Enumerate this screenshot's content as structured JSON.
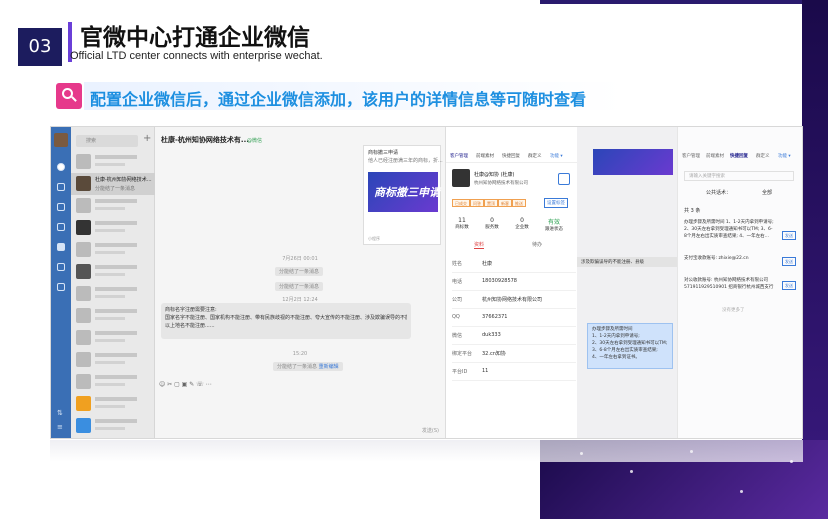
{
  "header": {
    "number": "03",
    "title": "官微中心打通企业微信",
    "subtitle": "Official LTD center connects with enterprise wechat."
  },
  "banner": {
    "text": "配置企业微信后，通过企业微信添加，该用户的详情信息等可随时查看"
  },
  "chat": {
    "search_placeholder": "搜索",
    "selected_name": "杜康-杭州知协网络技术...",
    "selected_preview": "分能结了一条消息",
    "title": "杜康-杭州知协网络技术有...",
    "tag": "@微信",
    "time1": "7月26日 00:01",
    "sys1": "分能结了一条消息",
    "sys2": "分能结了一条消息",
    "time2": "12月2日 12:24",
    "sys3": "分能结了一条消息",
    "msg_line1": "商标名字注册需要注意:",
    "msg_line2": "国家名字不能注册、国家机构不能注册、带有民族歧视的不能注册、夸大宣传的不能注册、涉及欺骗误导的不能注册、县级",
    "msg_line3": "以上地名不能注册......",
    "time3": "15:20",
    "sys4": "分能结了一条消息",
    "sys4_link": "重新编辑",
    "card_title": "商标撤三申请",
    "card_sub": "他人已经注册满三年的商标，折...",
    "card_logo": "商标撤三申请",
    "card_source": "小程序",
    "send_label": "发送(S)"
  },
  "profile": {
    "tabs": [
      "客户管理",
      "前端素材",
      "快捷回复",
      "群定义",
      "功能 ▾"
    ],
    "name": "杜康@知协 (杜康)",
    "company": "杭州知协网络技术有限公司",
    "tags": [
      "已成交",
      "问答",
      "置顶",
      "新客",
      "推送"
    ],
    "set_tag": "设置标签",
    "stats": [
      {
        "value": "11",
        "label": "商标数"
      },
      {
        "value": "0",
        "label": "服务数"
      },
      {
        "value": "0",
        "label": "企业数"
      },
      {
        "value": "有效",
        "label": "跟进状态"
      }
    ],
    "subtabs": [
      "资料",
      "待办"
    ],
    "fields": [
      {
        "key": "姓名",
        "value": "杜康"
      },
      {
        "key": "电话",
        "value": "18030928578"
      },
      {
        "key": "公司",
        "value": "杭州知协网络技术有限公司"
      },
      {
        "key": "QQ",
        "value": "37662371"
      },
      {
        "key": "微信",
        "value": "duk333"
      },
      {
        "key": "绑定平台",
        "value": "32.cn知协"
      },
      {
        "key": "平台ID",
        "value": "11"
      }
    ]
  },
  "right_panel": {
    "tabs": [
      "客户管理",
      "前端素材",
      "快捷回复",
      "群定义",
      "功能 ▾"
    ],
    "search_placeholder": "请输入关键字搜索",
    "filter_label": "公共话术：",
    "filter_value": "全部",
    "count": "共 3 条",
    "item1": "办理步骤及所需时间 1、1-2天内拿到申请号; 2、30天左右拿到受理通知书可以TM; 3、6-8个月左右出实质审查结果; 4、一年左右...",
    "item2": "支付宝收款账号: zhixie@22.cn",
    "item3": "对公收款账号: 杭州知协网络技术有限公司 571911929510901 招商银行杭州城西支行",
    "send": "发送",
    "no_more": "没有更多了",
    "chat_msg": "涉及欺骗误导的不能注册、县级",
    "blue_box": [
      "办理步骤及所需时间",
      "1、1-2天内拿到申请号;",
      "2、30天左右拿到受理通知书可以TM;",
      "3、6-8个月左右出实质审查结果;",
      "4、一年左右拿到证书。"
    ]
  },
  "colors": {
    "number_bg": "#1c1c5e",
    "banner_text": "#1d8fe0",
    "banner_icon": "#e6398b",
    "nav": "#3a6fb5",
    "accent_purple": "#3a1a80"
  }
}
